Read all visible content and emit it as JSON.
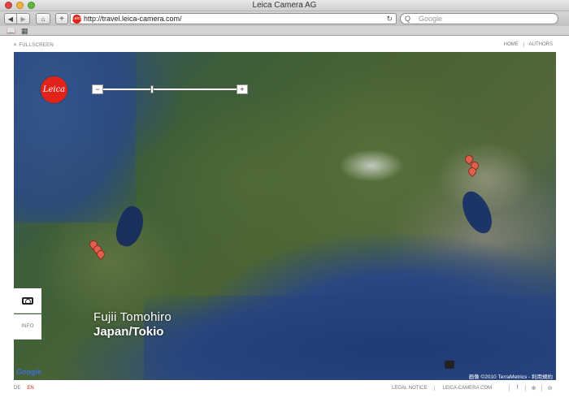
{
  "browser": {
    "window_title": "Leica Camera AG",
    "url": "http://travel.leica-camera.com/",
    "search_placeholder": "Google",
    "nav_back": "◀",
    "nav_forward": "▶",
    "home_icon": "⌂",
    "add_icon": "+",
    "reload_icon": "↻",
    "search_icon": "Q",
    "bookmark_icon": "📖",
    "grid_icon": "▦"
  },
  "page": {
    "fullscreen_label": "FULLSCREEN",
    "nav": [
      "HOME",
      "AUTHORS"
    ],
    "logo_text": "Leica",
    "zoom_out": "−",
    "zoom_in": "+",
    "info_label": "INFO",
    "caption": {
      "name": "Fujii Tomohiro",
      "place": "Japan/Tokio"
    },
    "google_logo": "Google",
    "map_credit": "画像 ©2010 TerraMetrics - 利用規約"
  },
  "footer": {
    "languages": [
      "DE",
      "EN"
    ],
    "active_language": "EN",
    "links": [
      "LEGAL NOTICE",
      "LEICA-CAMERA.COM"
    ],
    "social_icons": [
      "f",
      "⊕",
      "⊖"
    ]
  },
  "colors": {
    "brand_red": "#e2231a",
    "marker": "#e0604c"
  }
}
